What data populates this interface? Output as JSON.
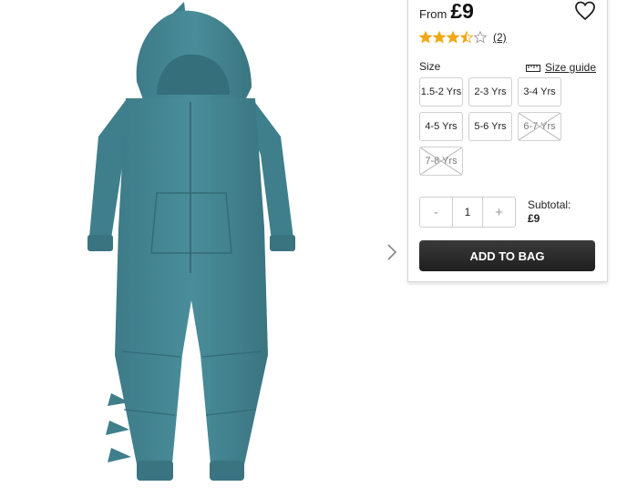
{
  "product": {
    "from_label": "From",
    "price": "£9",
    "rating": 3.5,
    "rating_max": 5,
    "review_count": "(2)"
  },
  "sizes": {
    "label": "Size",
    "guide_label": "Size guide",
    "options": [
      {
        "label": "1.5-2 Yrs",
        "available": true
      },
      {
        "label": "2-3 Yrs",
        "available": true
      },
      {
        "label": "3-4 Yrs",
        "available": true
      },
      {
        "label": "4-5 Yrs",
        "available": true
      },
      {
        "label": "5-6 Yrs",
        "available": true
      },
      {
        "label": "6-7 Yrs",
        "available": false
      },
      {
        "label": "7-8 Yrs",
        "available": false
      }
    ]
  },
  "quantity": {
    "minus": "-",
    "value": "1",
    "plus": "+"
  },
  "subtotal": {
    "label": "Subtotal:",
    "amount": "£9"
  },
  "cart": {
    "add_label": "ADD TO BAG"
  },
  "colors": {
    "accent": "#f0a818",
    "garment": "#3f7f8c",
    "button": "#2b2b2b"
  },
  "icons": [
    "heart-icon",
    "star-icon",
    "ruler-icon",
    "chevron-right-icon"
  ]
}
